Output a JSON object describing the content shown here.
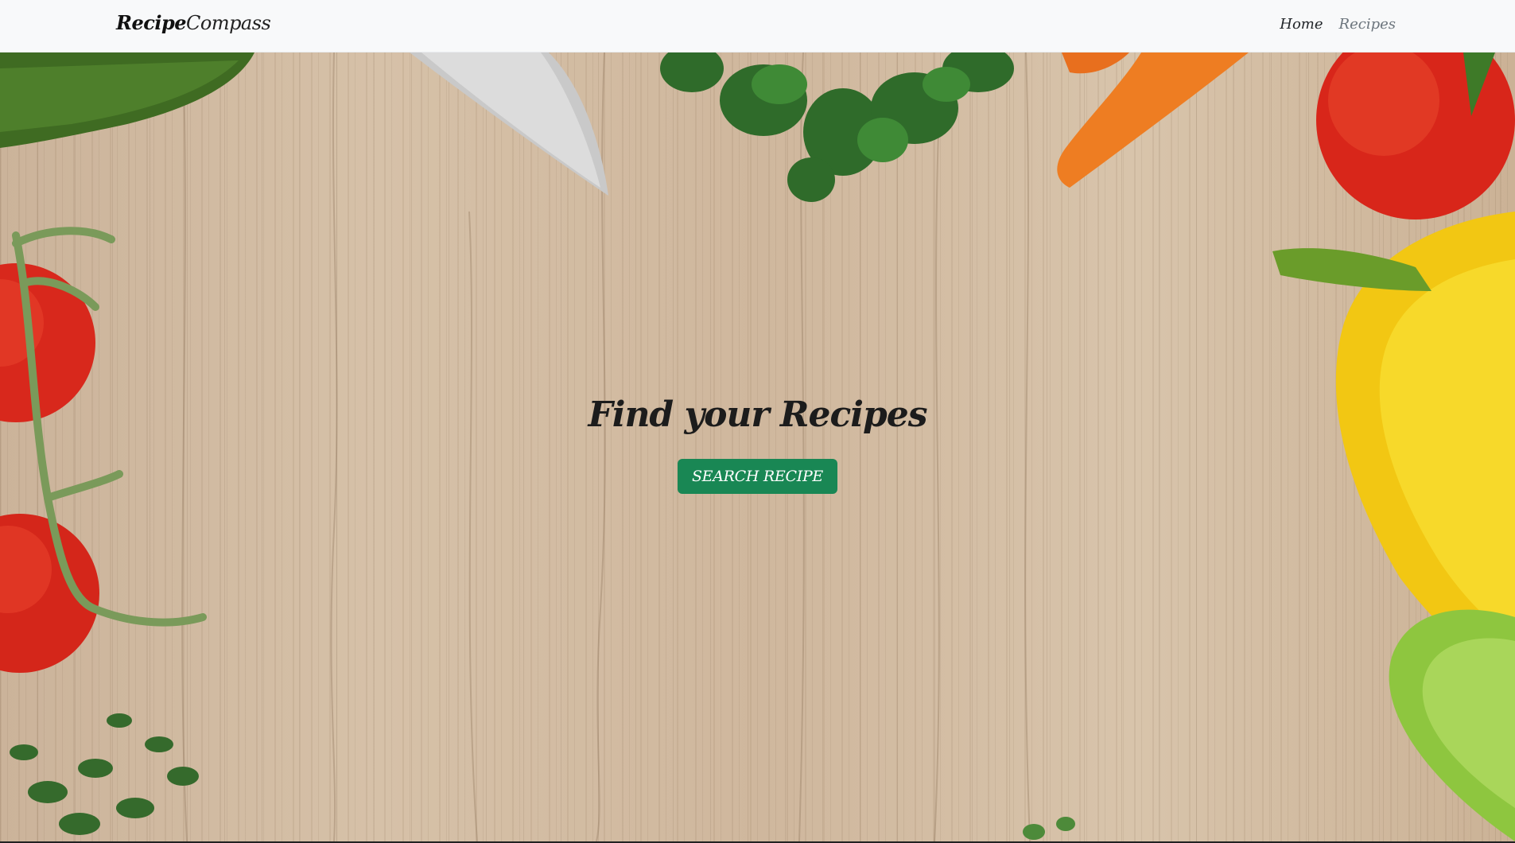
{
  "navbar": {
    "brand_bold": "Recipe",
    "brand_light": "Compass",
    "links": [
      {
        "label": "Home"
      },
      {
        "label": "Recipes"
      }
    ]
  },
  "hero": {
    "title": "Find your Recipes",
    "button_label": "SEARCH RECIPE",
    "background": "wooden cutting board with vegetables"
  },
  "colors": {
    "primary_button": "#198754",
    "navbar_bg": "#f8f9fa",
    "text_dark": "#212529",
    "text_muted": "#6c757d"
  }
}
